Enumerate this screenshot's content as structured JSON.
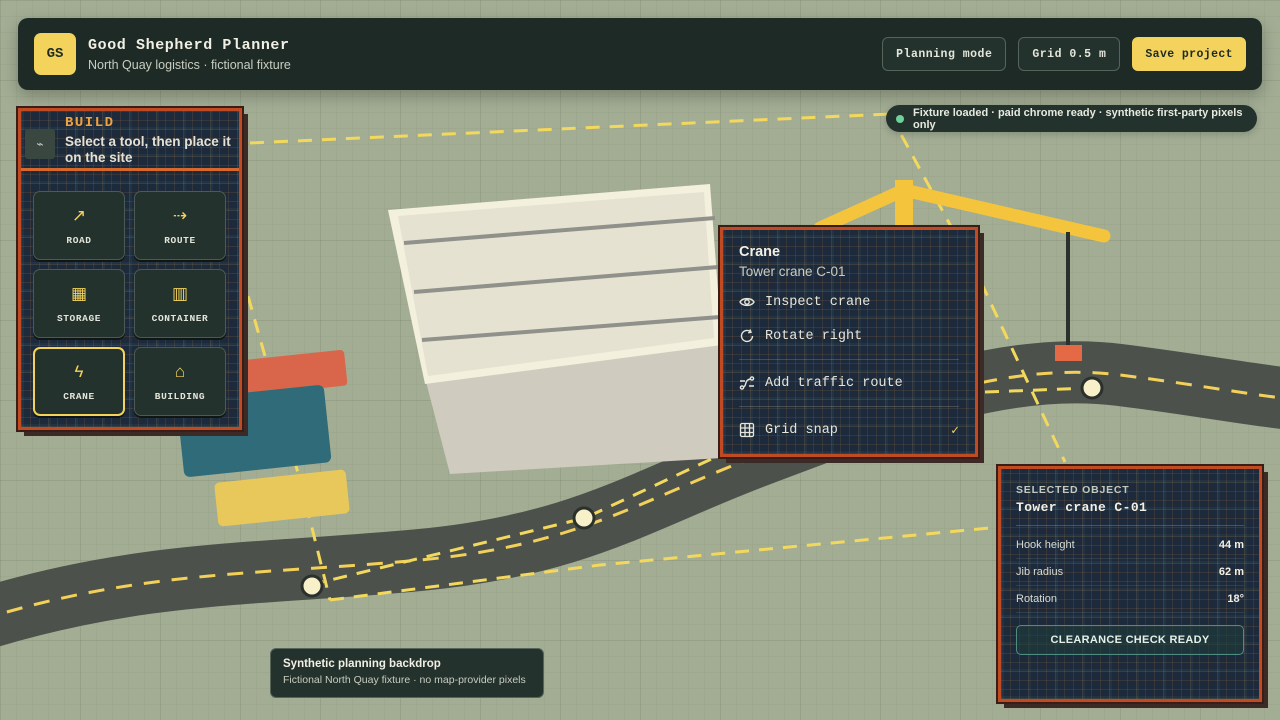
{
  "app": {
    "logo": "GS",
    "title": "Good Shepherd Planner",
    "subtitle": "North Quay logistics · fictional fixture"
  },
  "toolbar": {
    "planning_label": "Planning mode",
    "grid_label": "Grid 0.5 m",
    "save_label": "Save project"
  },
  "status": {
    "text": "Fixture loaded · paid chrome ready · synthetic first-party pixels only",
    "dot_color": "#6fd19a"
  },
  "build": {
    "title": "BUILD",
    "instruction": "Select a tool, then place it on the site",
    "tools": [
      {
        "label": "ROAD",
        "icon": "arrow-up-right-icon",
        "glyph": "↗"
      },
      {
        "label": "ROUTE",
        "icon": "dashed-arrow-icon",
        "glyph": "⇢"
      },
      {
        "label": "STORAGE",
        "icon": "storage-grid-icon",
        "glyph": "▦"
      },
      {
        "label": "CONTAINER",
        "icon": "container-icon",
        "glyph": "▥"
      },
      {
        "label": "CRANE",
        "icon": "crane-icon",
        "glyph": "ϟ"
      },
      {
        "label": "BUILDING",
        "icon": "building-icon",
        "glyph": "⌂"
      }
    ]
  },
  "context_menu": {
    "title": "Crane",
    "subtitle": "Tower crane C-01",
    "items": [
      {
        "label": "Inspect crane",
        "icon": "eye-icon"
      },
      {
        "label": "Rotate right",
        "icon": "rotate-right-icon"
      },
      {
        "label": "Add traffic route",
        "icon": "route-icon"
      },
      {
        "label": "Grid snap",
        "icon": "grid-icon",
        "checked": true
      }
    ]
  },
  "selected": {
    "label": "SELECTED OBJECT",
    "name": "Tower crane C-01",
    "rows": [
      {
        "key": "Hook height",
        "value": "44 m"
      },
      {
        "key": "Jib radius",
        "value": "62 m"
      },
      {
        "key": "Rotation",
        "value": "18°"
      }
    ],
    "action": "CLEARANCE CHECK READY"
  },
  "caption": {
    "title": "Synthetic planning backdrop",
    "subtitle": "Fictional North Quay fixture · no map-provider pixels"
  },
  "colors": {
    "accent_yellow": "#f3d35c",
    "panel_dark": "#1e2a26",
    "tartan_border": "#c04a22",
    "build_orange": "#f2a23c"
  }
}
